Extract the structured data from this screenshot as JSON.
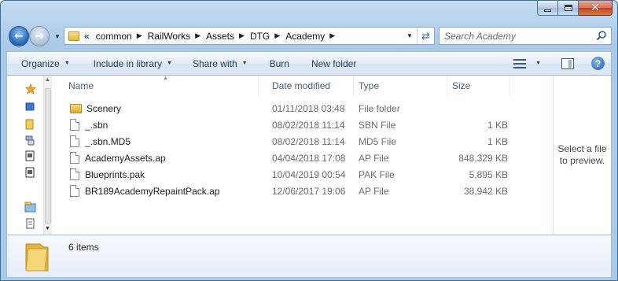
{
  "window": {
    "minimize_icon": "minimize-icon",
    "maximize_icon": "maximize-icon",
    "close_icon": "close-icon"
  },
  "address": {
    "overflow": "«",
    "crumbs": [
      "common",
      "RailWorks",
      "Assets",
      "DTG",
      "Academy"
    ]
  },
  "search": {
    "placeholder": "Search Academy"
  },
  "toolbar": {
    "organize": "Organize",
    "include_in_library": "Include in library",
    "share_with": "Share with",
    "burn": "Burn",
    "new_folder": "New folder"
  },
  "columns": {
    "name": "Name",
    "date_modified": "Date modified",
    "type": "Type",
    "size": "Size"
  },
  "files": [
    {
      "name": "Scenery",
      "date": "01/11/2018 03:48",
      "type": "File folder",
      "size": "",
      "icon": "folder-icon"
    },
    {
      "name": "_.sbn",
      "date": "08/02/2018 11:14",
      "type": "SBN File",
      "size": "1 KB",
      "icon": "file-icon"
    },
    {
      "name": "_.sbn.MD5",
      "date": "08/02/2018 11:14",
      "type": "MD5 File",
      "size": "1 KB",
      "icon": "file-icon"
    },
    {
      "name": "AcademyAssets.ap",
      "date": "04/04/2018 17:08",
      "type": "AP File",
      "size": "848,329 KB",
      "icon": "file-icon"
    },
    {
      "name": "Blueprints.pak",
      "date": "10/04/2019 00:54",
      "type": "PAK File",
      "size": "5,895 KB",
      "icon": "file-icon"
    },
    {
      "name": "BR189AcademyRepaintPack.ap",
      "date": "12/06/2017 19:06",
      "type": "AP File",
      "size": "38,942 KB",
      "icon": "file-icon"
    }
  ],
  "preview": {
    "line1": "Select a file",
    "line2": "to preview."
  },
  "details": {
    "item_count": "6 items"
  },
  "colors": {
    "frame": "#b7d3ee",
    "accent": "#2b6fc0",
    "folder": "#e4b93f"
  }
}
